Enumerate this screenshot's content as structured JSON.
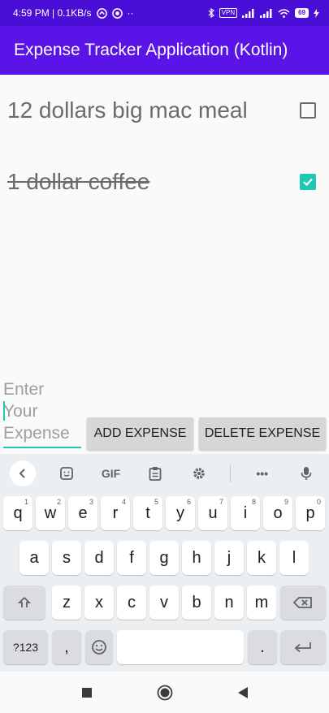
{
  "status_bar": {
    "time_speed": "4:59 PM | 0.1KB/s",
    "dots": "··",
    "vpn": "VPN",
    "battery": "69"
  },
  "app_bar": {
    "title": "Expense Tracker Application (Kotlin)"
  },
  "expenses": [
    {
      "text": "12 dollars big mac meal",
      "checked": false
    },
    {
      "text": "1 dollar coffee",
      "checked": true
    }
  ],
  "input": {
    "placeholder": "Enter Your Expense"
  },
  "buttons": {
    "add": "ADD EXPENSE",
    "delete": "DELETE EXPENSE"
  },
  "keyboard": {
    "gif": "GIF",
    "more": "•••",
    "row1": [
      {
        "k": "q",
        "h": "1"
      },
      {
        "k": "w",
        "h": "2"
      },
      {
        "k": "e",
        "h": "3"
      },
      {
        "k": "r",
        "h": "4"
      },
      {
        "k": "t",
        "h": "5"
      },
      {
        "k": "y",
        "h": "6"
      },
      {
        "k": "u",
        "h": "7"
      },
      {
        "k": "i",
        "h": "8"
      },
      {
        "k": "o",
        "h": "9"
      },
      {
        "k": "p",
        "h": "0"
      }
    ],
    "row2": [
      "a",
      "s",
      "d",
      "f",
      "g",
      "h",
      "j",
      "k",
      "l"
    ],
    "row3": [
      "z",
      "x",
      "c",
      "v",
      "b",
      "n",
      "m"
    ],
    "symbols": "?123",
    "comma": ",",
    "period": ".",
    "accent": "#1ec9b3"
  }
}
